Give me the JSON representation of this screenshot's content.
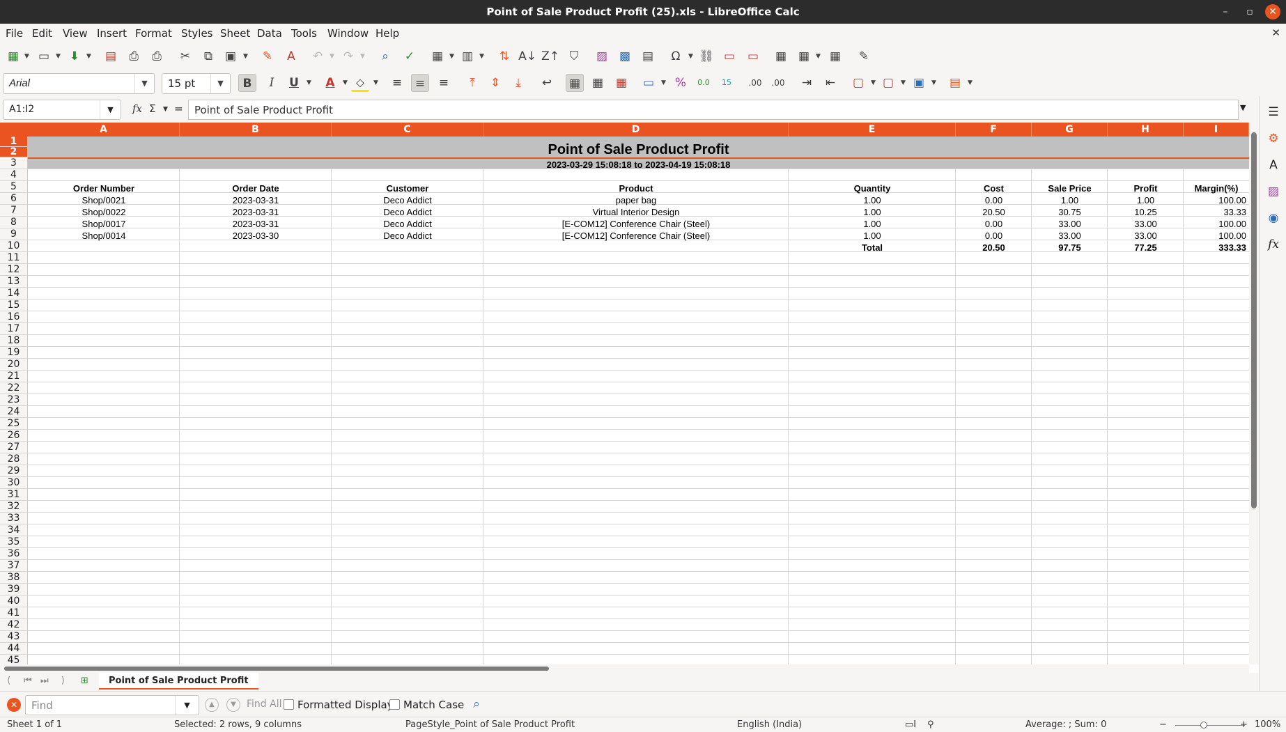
{
  "window": {
    "title": "Point of Sale Product Profit (25).xls - LibreOffice Calc"
  },
  "menu": [
    "File",
    "Edit",
    "View",
    "Insert",
    "Format",
    "Styles",
    "Sheet",
    "Data",
    "Tools",
    "Window",
    "Help"
  ],
  "toolbar": {
    "font_name": "Arial",
    "font_size": "15 pt"
  },
  "formula_bar": {
    "cell_ref": "A1:I2",
    "content": "Point of Sale Product Profit"
  },
  "columns": [
    "A",
    "B",
    "C",
    "D",
    "E",
    "F",
    "G",
    "H",
    "I"
  ],
  "rows": [
    "1",
    "2",
    "3",
    "4",
    "5",
    "6",
    "7",
    "8",
    "9",
    "10",
    "11",
    "12",
    "13",
    "14",
    "15",
    "16",
    "17",
    "18",
    "19",
    "20",
    "21",
    "22",
    "23",
    "24",
    "25",
    "26",
    "27",
    "28",
    "29",
    "30",
    "31",
    "32",
    "33",
    "34",
    "35",
    "36",
    "37",
    "38",
    "39",
    "40",
    "41",
    "42",
    "43",
    "44",
    "45"
  ],
  "sheet": {
    "title": "Point of Sale Product Profit",
    "subtitle": "2023-03-29 15:08:18 to 2023-04-19 15:08:18",
    "headers": [
      "Order Number",
      "Order Date",
      "Customer",
      "Product",
      "Quantity",
      "Cost",
      "Sale Price",
      "Profit",
      "Margin(%)"
    ],
    "rows": [
      [
        "Shop/0021",
        "2023-03-31",
        "Deco Addict",
        "paper bag",
        "1.00",
        "0.00",
        "1.00",
        "1.00",
        "100.00"
      ],
      [
        "Shop/0022",
        "2023-03-31",
        "Deco Addict",
        "Virtual Interior Design",
        "1.00",
        "20.50",
        "30.75",
        "10.25",
        "33.33"
      ],
      [
        "Shop/0017",
        "2023-03-31",
        "Deco Addict",
        "[E-COM12] Conference Chair (Steel)",
        "1.00",
        "0.00",
        "33.00",
        "33.00",
        "100.00"
      ],
      [
        "Shop/0014",
        "2023-03-30",
        "Deco Addict",
        "[E-COM12] Conference Chair (Steel)",
        "1.00",
        "0.00",
        "33.00",
        "33.00",
        "100.00"
      ]
    ],
    "total_label": "Total",
    "totals": [
      "20.50",
      "97.75",
      "77.25",
      "333.33"
    ]
  },
  "tabs": {
    "sheet_tab": "Point of Sale Product Profit"
  },
  "find": {
    "placeholder": "Find",
    "find_all": "Find All",
    "formatted_display": "Formatted Display",
    "match_case": "Match Case"
  },
  "status": {
    "sheet": "Sheet 1 of 1",
    "selection": "Selected: 2 rows, 9 columns",
    "page_style": "PageStyle_Point of Sale Product Profit",
    "language": "English (India)",
    "summary": "Average: ; Sum: 0",
    "zoom": "100%"
  },
  "colors": {
    "accent": "#e95420",
    "band": "#c0c0c0",
    "titlebar": "#2c2c2c"
  }
}
